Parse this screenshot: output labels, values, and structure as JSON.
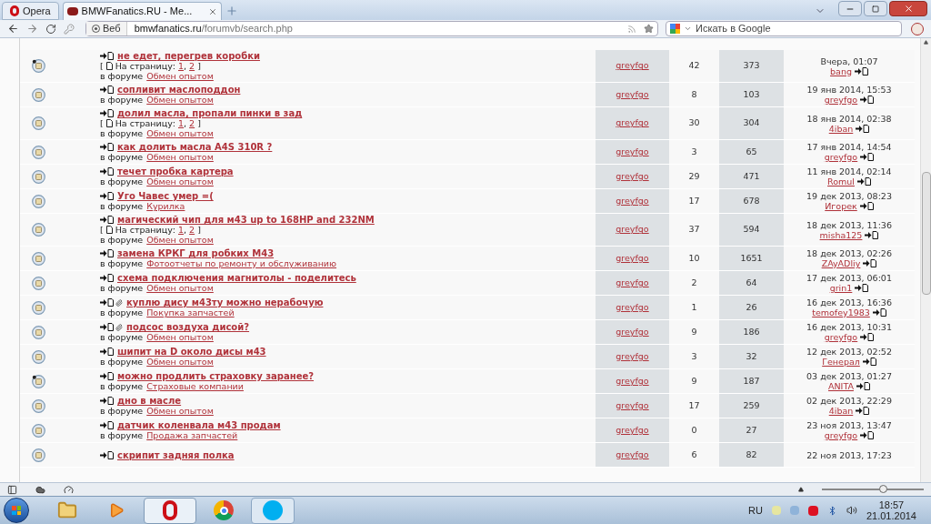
{
  "browser": {
    "menu_label": "Opera",
    "tabs": [
      {
        "label": "BMWFanatics.RU - Ме...",
        "selected": true
      }
    ],
    "address": {
      "badge": "Веб",
      "domain": "bmwfanatics.ru",
      "path": "/forumvb/search.php"
    },
    "search": {
      "placeholder": "Искать в Google"
    }
  },
  "topics": [
    {
      "title": "не едет, перегрев коробки",
      "new": true,
      "attachment": false,
      "pager": {
        "open": "[",
        "label": "На страницу:",
        "links": [
          "1",
          "2"
        ],
        "separator": ",",
        "close": "]"
      },
      "in_forum": "в форуме",
      "forum": "Обмен опытом",
      "author": "greyfgo",
      "replies": "42",
      "views": "373",
      "last_date": "Вчера, 01:07",
      "last_user": "bang"
    },
    {
      "title": "сопливит маслоподдон",
      "new": false,
      "attachment": false,
      "in_forum": "в форуме",
      "forum": "Обмен опытом",
      "author": "greyfgo",
      "replies": "8",
      "views": "103",
      "last_date": "19 янв 2014, 15:53",
      "last_user": "greyfgo"
    },
    {
      "title": "долил масла, пропали пинки в зад",
      "new": false,
      "attachment": false,
      "pager": {
        "open": "[",
        "label": "На страницу:",
        "links": [
          "1",
          "2"
        ],
        "separator": ",",
        "close": "]"
      },
      "in_forum": "в форуме",
      "forum": "Обмен опытом",
      "author": "greyfgo",
      "replies": "30",
      "views": "304",
      "last_date": "18 янв 2014, 02:38",
      "last_user": "4iban"
    },
    {
      "title": "как долить масла A4S 310R ?",
      "new": false,
      "attachment": false,
      "in_forum": "в форуме",
      "forum": "Обмен опытом",
      "author": "greyfgo",
      "replies": "3",
      "views": "65",
      "last_date": "17 янв 2014, 14:54",
      "last_user": "greyfgo"
    },
    {
      "title": "течет пробка картера",
      "new": false,
      "attachment": false,
      "in_forum": "в форуме",
      "forum": "Обмен опытом",
      "author": "greyfgo",
      "replies": "29",
      "views": "471",
      "last_date": "11 янв 2014, 02:14",
      "last_user": "Romul"
    },
    {
      "title": "Уго Чавес умер =(",
      "new": false,
      "attachment": false,
      "in_forum": "в форуме",
      "forum": "Курилка",
      "author": "greyfgo",
      "replies": "17",
      "views": "678",
      "last_date": "19 дек 2013, 08:23",
      "last_user": "Игорек"
    },
    {
      "title": "магический чип для м43 up to 168HP and 232NM",
      "new": false,
      "attachment": false,
      "pager": {
        "open": "[",
        "label": "На страницу:",
        "links": [
          "1",
          "2"
        ],
        "separator": ",",
        "close": "]"
      },
      "in_forum": "в форуме",
      "forum": "Обмен опытом",
      "author": "greyfgo",
      "replies": "37",
      "views": "594",
      "last_date": "18 дек 2013, 11:36",
      "last_user": "misha125"
    },
    {
      "title": "замена КРКГ для робких М43",
      "new": false,
      "attachment": false,
      "in_forum": "в форуме",
      "forum": "Фотоотчеты по ремонту и обслуживанию",
      "author": "greyfgo",
      "replies": "10",
      "views": "1651",
      "last_date": "18 дек 2013, 02:26",
      "last_user": "ZAyADliy"
    },
    {
      "title": "схема подключения магнитолы - поделитесь",
      "new": false,
      "attachment": false,
      "in_forum": "в форуме",
      "forum": "Обмен опытом",
      "author": "greyfgo",
      "replies": "2",
      "views": "64",
      "last_date": "17 дек 2013, 06:01",
      "last_user": "grin1"
    },
    {
      "title": "куплю дису м43ту можно нерабочую",
      "new": false,
      "attachment": true,
      "in_forum": "в форуме",
      "forum": "Покупка запчастей",
      "author": "greyfgo",
      "replies": "1",
      "views": "26",
      "last_date": "16 дек 2013, 16:36",
      "last_user": "temofey1983"
    },
    {
      "title": "подсос воздуха дисой?",
      "new": false,
      "attachment": true,
      "in_forum": "в форуме",
      "forum": "Обмен опытом",
      "author": "greyfgo",
      "replies": "9",
      "views": "186",
      "last_date": "16 дек 2013, 10:31",
      "last_user": "greyfgo"
    },
    {
      "title": "шипит на D около дисы м43",
      "new": false,
      "attachment": false,
      "in_forum": "в форуме",
      "forum": "Обмен опытом",
      "author": "greyfgo",
      "replies": "3",
      "views": "32",
      "last_date": "12 дек 2013, 02:52",
      "last_user": "Генерал"
    },
    {
      "title": "можно продлить страховку заранее?",
      "new": true,
      "attachment": false,
      "in_forum": "в форуме",
      "forum": "Страховые компании",
      "author": "greyfgo",
      "replies": "9",
      "views": "187",
      "last_date": "03 дек 2013, 01:27",
      "last_user": "ANITA"
    },
    {
      "title": "дно в масле",
      "new": false,
      "attachment": false,
      "in_forum": "в форуме",
      "forum": "Обмен опытом",
      "author": "greyfgo",
      "replies": "17",
      "views": "259",
      "last_date": "02 дек 2013, 22:29",
      "last_user": "4iban"
    },
    {
      "title": "датчик коленвала м43 продам",
      "new": false,
      "attachment": false,
      "in_forum": "в форуме",
      "forum": "Продажа запчастей",
      "author": "greyfgo",
      "replies": "0",
      "views": "27",
      "last_date": "23 ноя 2013, 13:47",
      "last_user": "greyfgo"
    },
    {
      "title": "скрипит задняя полка",
      "new": false,
      "attachment": false,
      "author": "greyfgo",
      "replies": "6",
      "views": "82",
      "last_date": "22 ноя 2013, 17:23"
    }
  ],
  "zoom": {
    "level": 0.6
  },
  "tray": {
    "language": "RU",
    "time": "18:57",
    "date": "21.01.2014"
  }
}
